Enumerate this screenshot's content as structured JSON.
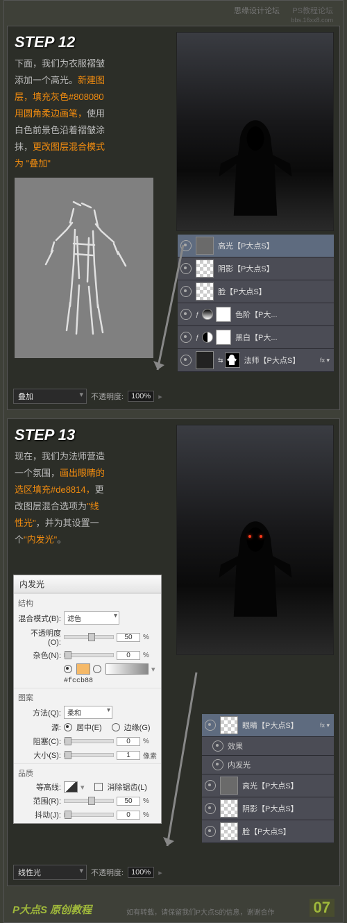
{
  "header": {
    "wm_left": "思缘设计论坛",
    "wm_right": "PS教程论坛",
    "wm_url": "bbs.16xx8.com"
  },
  "step12": {
    "title": "STEP 12",
    "line1": "下面，我们为衣服褶皱",
    "line2": "添加一个高光。",
    "line2b": "新建图",
    "line3": "层，填充灰色#808080",
    "line4": "用圆角柔边画笔，",
    "line4b": "使用",
    "line5": "白色前景色沿着褶皱涂",
    "line6": "抹，",
    "line6b": "更改图层混合模式",
    "line7": "为",
    "line7q": "\"叠加\"",
    "blend": {
      "mode": "叠加",
      "opacityLabel": "不透明度:",
      "opacity": "100%"
    },
    "layers": [
      {
        "name": "高光【P大点S】",
        "selected": true,
        "thumb": "gray"
      },
      {
        "name": "阴影【P大点S】",
        "thumb": "checker"
      },
      {
        "name": "脸【P大点S】",
        "thumb": "checker"
      },
      {
        "name": "色阶【P大...",
        "adj": "lvl",
        "mask": true
      },
      {
        "name": "黑白【P大...",
        "adj": "half",
        "mask": true
      },
      {
        "name": "法师【P大点S】",
        "thumb": "dark",
        "linkmask": true,
        "fx": true
      }
    ]
  },
  "step13": {
    "title": "STEP 13",
    "line1": "现在，我们为法师营造",
    "line2": "一个氛围，",
    "line2b": "画出眼睛的",
    "line3": "选区填充#de8814，",
    "line3b": "更",
    "line4": "改图层混合选项为",
    "line4q": "\"线",
    "line5": "性光\"",
    "line5b": "，并为其设置一",
    "line6": "个",
    "line6q": "\"内发光\"",
    "line6b": "。",
    "blend": {
      "mode": "线性光",
      "opacityLabel": "不透明度:",
      "opacity": "100%"
    },
    "fx": {
      "title": "内发光",
      "structLabel": "结构",
      "blendLabel": "混合模式(B):",
      "blendVal": "滤色",
      "opLabel": "不透明度(O):",
      "opVal": "50",
      "opUnit": "%",
      "noiseLabel": "杂色(N):",
      "noiseVal": "0",
      "noiseUnit": "%",
      "colorHex": "#fccb88",
      "patternLabel": "图案",
      "methodLabel": "方法(Q):",
      "methodVal": "柔和",
      "sourceLabel": "源:",
      "sourceA": "居中(E)",
      "sourceB": "边缘(G)",
      "chokeLabel": "阻塞(C):",
      "chokeVal": "0",
      "chokeUnit": "%",
      "sizeLabel": "大小(S):",
      "sizeVal": "1",
      "sizeUnit": "像素",
      "qualityLabel": "品质",
      "contourLabel": "等高线:",
      "antiLabel": "消除锯齿(L)",
      "rangeLabel": "范围(R):",
      "rangeVal": "50",
      "rangeUnit": "%",
      "jitterLabel": "抖动(J):",
      "jitterVal": "0",
      "jitterUnit": "%"
    },
    "layers": [
      {
        "name": "眼睛【P大点S】",
        "selected": true,
        "thumb": "checker",
        "fx": true
      },
      {
        "name": "效果",
        "sub": true
      },
      {
        "name": "内发光",
        "sub": true
      },
      {
        "name": "高光【P大点S】",
        "thumb": "gray"
      },
      {
        "name": "阴影【P大点S】",
        "thumb": "checker"
      },
      {
        "name": "脸【P大点S】",
        "thumb": "checker"
      }
    ]
  },
  "footer": {
    "brand": "P大点S 原创教程",
    "note": "如有转载，请保留我们P大点S的信息，谢谢合作",
    "page": "07"
  }
}
